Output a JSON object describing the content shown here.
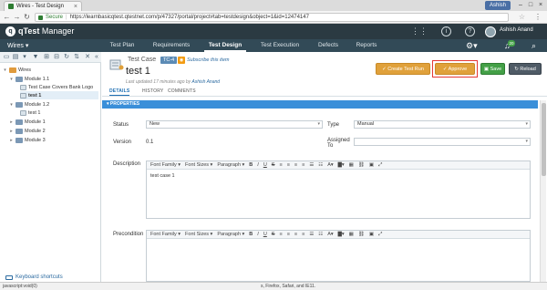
{
  "browser": {
    "tab_title": "Wires - Test Design",
    "user_chip": "Ashish",
    "secure_label": "Secure",
    "url": "https://learnbasicqtest.qtestnet.com/p/47327/portal/project#tab=testdesign&object=1&id=12474147"
  },
  "app": {
    "brand": "qTest",
    "brand_suffix": "Manager",
    "user_name": "Ashish Anand",
    "notifications_count": "20",
    "project": "Wires ▾"
  },
  "nav": {
    "tabs": [
      "Test Plan",
      "Requirements",
      "Test Design",
      "Test Execution",
      "Defects",
      "Reports"
    ],
    "active": "Test Design"
  },
  "tree": {
    "root": "Wires",
    "items": [
      {
        "label": "Module 1.1",
        "kind": "folder"
      },
      {
        "label": "Test Case Covers Bank Logo",
        "kind": "testcase"
      },
      {
        "label": "test 1",
        "kind": "testcase"
      },
      {
        "label": "Module 1.2",
        "kind": "folder"
      },
      {
        "label": "test 1",
        "kind": "testcase"
      },
      {
        "label": "Module 1",
        "kind": "folder"
      },
      {
        "label": "Module 2",
        "kind": "folder"
      },
      {
        "label": "Module 3",
        "kind": "folder"
      }
    ],
    "keyboard_shortcuts": "Keyboard shortcuts"
  },
  "testcase": {
    "type_label": "Test Case",
    "id_badge": "TC-4",
    "rss_icon": "rss-icon",
    "subscribe": "Subscribe this item",
    "title": "test 1",
    "updated_prefix": "Last updated 17 minutes ago by",
    "updated_author": "Ashish Anand"
  },
  "actions": {
    "create_test_run": "Create Test Run",
    "approve": "Approve",
    "save": "Save",
    "reload": "Reload"
  },
  "subtabs": [
    "DETAILS",
    "HISTORY",
    "COMMENTS"
  ],
  "properties": {
    "header": "▾ PROPERTIES",
    "status_label": "Status",
    "status_value": "New",
    "type_label": "Type",
    "type_value": "Manual",
    "version_label": "Version",
    "version_value": "0.1",
    "assigned_label_1": "Assigned",
    "assigned_label_2": "To",
    "assigned_value": "",
    "description_label": "Description",
    "description_text": "test case 1",
    "precondition_label": "Precondition",
    "precondition_text": ""
  },
  "editor": {
    "font_family": "Font Family ▾",
    "font_sizes": "Font Sizes ▾",
    "paragraph": "Paragraph ▾"
  },
  "status_bar": {
    "left": "javascript:void(0)",
    "middle": "s, Firefox, Safari, and IE11."
  },
  "colors": {
    "header_bg": "#2b3a42",
    "nav_bg": "#324a57",
    "accent": "#3a8fd9",
    "approve_bg": "#e0a13b",
    "save_bg": "#43a047",
    "highlight_frame": "#e53935"
  }
}
